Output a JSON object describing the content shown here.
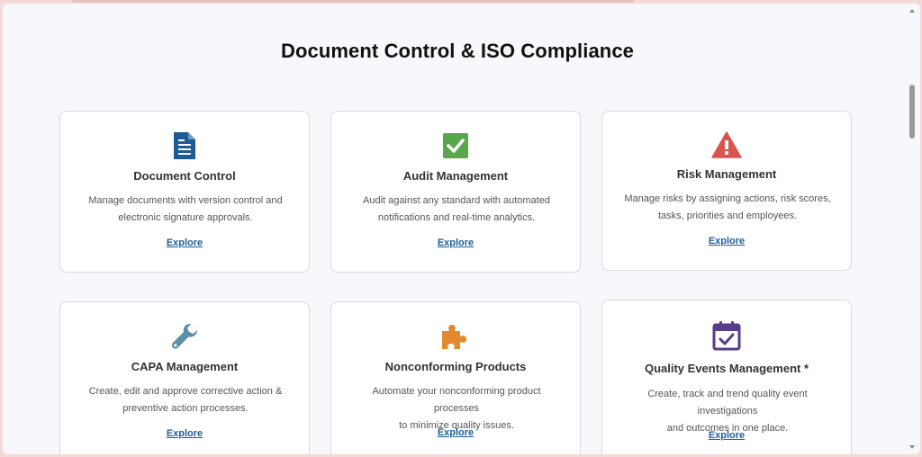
{
  "page": {
    "title": "Document Control & ISO Compliance"
  },
  "cards": [
    {
      "icon": "document-icon",
      "title": "Document Control",
      "description_line1": "Manage documents with version control and",
      "description_line2": "electronic signature approvals.",
      "link": "Explore",
      "icon_color": "#1e5a96"
    },
    {
      "icon": "checkbox-check-icon",
      "title": "Audit Management",
      "description_line1": "Audit against any standard with automated",
      "description_line2": "notifications and real-time analytics.",
      "link": "Explore",
      "icon_color": "#5aa64a"
    },
    {
      "icon": "warning-triangle-icon",
      "title": "Risk Management",
      "description_line1": "Manage risks by assigning actions, risk scores,",
      "description_line2": "tasks, priorities and employees.",
      "link": "Explore",
      "icon_color": "#d9534f"
    },
    {
      "icon": "wrench-icon",
      "title": "CAPA Management",
      "description_line1": "Create, edit and approve corrective action &",
      "description_line2": "preventive action processes.",
      "link": "Explore",
      "icon_color": "#5b8fa8"
    },
    {
      "icon": "puzzle-piece-icon",
      "title": "Nonconforming Products",
      "description_line1": "Automate your nonconforming product processes",
      "description_line2": "to minimize quality issues.",
      "link": "Explore",
      "icon_color": "#e38a2e"
    },
    {
      "icon": "calendar-check-icon",
      "title": "Quality Events Management *",
      "description_line1": "Create, track and trend quality event investigations",
      "description_line2": "and outcomes in one place.",
      "link": "Explore",
      "icon_color": "#5a3d8a"
    }
  ]
}
